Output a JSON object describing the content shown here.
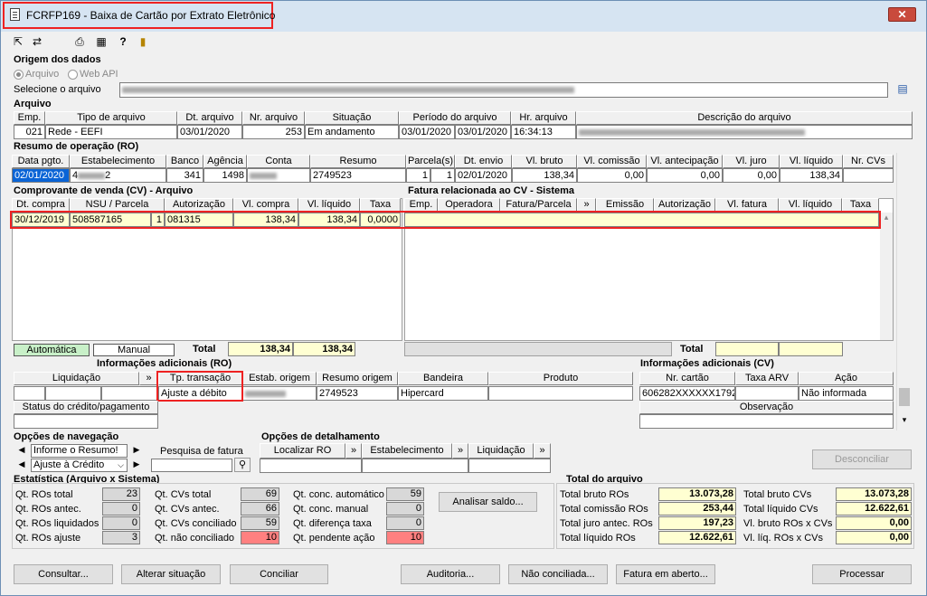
{
  "window": {
    "title": "FCRFP169 - Baixa de Cartão por Extrato Eletrônico",
    "close": "✕"
  },
  "toolbar": {
    "icons": [
      "exit-icon",
      "filter-icon",
      "print-icon",
      "calculator-icon",
      "help-icon",
      "door-icon"
    ]
  },
  "origem": {
    "section": "Origem dos dados",
    "radio1": "Arquivo",
    "radio2": "Web API",
    "file_label": "Selecione o arquivo"
  },
  "arquivo": {
    "section": "Arquivo",
    "headers": [
      "Emp.",
      "Tipo de arquivo",
      "Dt. arquivo",
      "Nr. arquivo",
      "Situação",
      "Período do arquivo",
      "Hr. arquivo",
      "Descrição do arquivo"
    ],
    "row": {
      "emp": "021",
      "tipo": "Rede - EEFI",
      "dt": "03/01/2020",
      "nr": "253",
      "situacao": "Em andamento",
      "per1": "03/01/2020",
      "per2": "03/01/2020",
      "hr": "16:34:13"
    }
  },
  "ro": {
    "section": "Resumo de operação (RO)",
    "headers": [
      "Data pgto.",
      "Estabelecimento",
      "Banco",
      "Agência",
      "Conta",
      "Resumo",
      "Parcela(s)",
      "Dt. envio",
      "Vl. bruto",
      "Vl. comissão",
      "Vl. antecipação",
      "Vl. juro",
      "Vl. líquido",
      "Nr. CVs"
    ],
    "row": {
      "data": "02/01/2020",
      "estab_a": "4",
      "estab_b": "2",
      "banco": "341",
      "agencia": "1498",
      "resumo": "2749523",
      "parc1": "1",
      "parc2": "1",
      "envio": "02/01/2020",
      "bruto": "138,34",
      "comissao": "0,00",
      "antecip": "0,00",
      "juro": "0,00",
      "liquido": "138,34"
    }
  },
  "cv": {
    "section": "Comprovante de venda (CV) - Arquivo",
    "headers": [
      "Dt. compra",
      "NSU / Parcela",
      "Autorização",
      "Vl. compra",
      "Vl. líquido",
      "Taxa"
    ],
    "row": {
      "dt": "30/12/2019",
      "nsu": "508587165",
      "parc": "1",
      "aut": "081315",
      "compra": "138,34",
      "liquido": "138,34",
      "taxa": "0,0000"
    },
    "legend_auto": "Automática",
    "legend_manual": "Manual",
    "total_label": "Total",
    "total_compra": "138,34",
    "total_liquido": "138,34"
  },
  "fatura": {
    "section": "Fatura relacionada ao CV - Sistema",
    "headers": [
      "Emp.",
      "Operadora",
      "Fatura/Parcela",
      "»",
      "Emissão",
      "Autorização",
      "Vl. fatura",
      "Vl. líquido",
      "Taxa"
    ],
    "total_label": "Total"
  },
  "info_ro": {
    "section": "Informações adicionais (RO)",
    "headers": [
      "Liquidação",
      "»",
      "Tp. transação",
      "Estab. origem",
      "Resumo origem",
      "Bandeira",
      "Produto"
    ],
    "row": {
      "tp": "Ajuste a débito",
      "resumo": "2749523",
      "bandeira": "Hipercard"
    },
    "status_label": "Status do crédito/pagamento"
  },
  "info_cv": {
    "section": "Informações adicionais (CV)",
    "headers": [
      "Nr. cartão",
      "Taxa ARV",
      "Ação"
    ],
    "row": {
      "cartao": "606282XXXXXX1792",
      "acao": "Não informada"
    },
    "obs_label": "Observação"
  },
  "nav": {
    "section": "Opções de navegação",
    "item1": "Informe o Resumo!",
    "item2": "Ajuste à Crédito",
    "search_label": "Pesquisa de fatura"
  },
  "detalhe": {
    "section": "Opções de detalhamento",
    "b1": "Localizar RO",
    "b2": "Estabelecimento",
    "b3": "Liquidação",
    "arrow": "»"
  },
  "desconciliar": "Desconciliar",
  "estat": {
    "section": "Estatística (Arquivo x Sistema)",
    "c1": [
      {
        "l": "Qt. ROs total",
        "v": "23"
      },
      {
        "l": "Qt. ROs antec.",
        "v": "0"
      },
      {
        "l": "Qt. ROs liquidados",
        "v": "0"
      },
      {
        "l": "Qt. ROs ajuste",
        "v": "3"
      }
    ],
    "c2": [
      {
        "l": "Qt. CVs total",
        "v": "69"
      },
      {
        "l": "Qt. CVs antec.",
        "v": "66"
      },
      {
        "l": "Qt. CVs conciliado",
        "v": "59"
      },
      {
        "l": "Qt. não conciliado",
        "v": "10"
      }
    ],
    "c3": [
      {
        "l": "Qt. conc. automático",
        "v": "59"
      },
      {
        "l": "Qt. conc. manual",
        "v": "0"
      },
      {
        "l": "Qt. diferença taxa",
        "v": "0"
      },
      {
        "l": "Qt. pendente ação",
        "v": "10"
      }
    ],
    "analisar": "Analisar saldo..."
  },
  "total_arq": {
    "section": "Total do arquivo",
    "c1": [
      {
        "l": "Total bruto ROs",
        "v": "13.073,28"
      },
      {
        "l": "Total comissão ROs",
        "v": "253,44"
      },
      {
        "l": "Total juro antec. ROs",
        "v": "197,23"
      },
      {
        "l": "Total líquido ROs",
        "v": "12.622,61"
      }
    ],
    "c2": [
      {
        "l": "Total bruto CVs",
        "v": "13.073,28"
      },
      {
        "l": "Total líquido CVs",
        "v": "12.622,61"
      },
      {
        "l": "Vl. bruto ROs x CVs",
        "v": "0,00"
      },
      {
        "l": "Vl. líq. ROs x CVs",
        "v": "0,00"
      }
    ]
  },
  "buttons": {
    "consultar": "Consultar...",
    "alterar": "Alterar situação",
    "conciliar": "Conciliar",
    "auditoria": "Auditoria...",
    "nao_conc": "Não conciliada...",
    "fatura": "Fatura em aberto...",
    "processar": "Processar"
  }
}
